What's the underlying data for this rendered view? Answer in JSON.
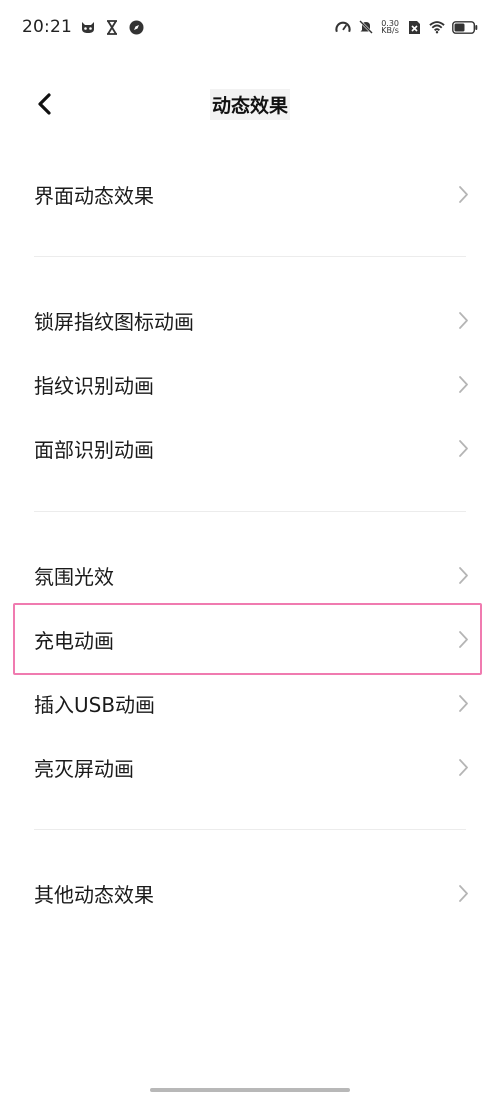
{
  "status_bar": {
    "time": "20:21",
    "net_speed_value": "0.30",
    "net_speed_unit": "KB/s"
  },
  "header": {
    "title": "动态效果"
  },
  "groups": [
    {
      "items": [
        {
          "label": "界面动态效果"
        }
      ]
    },
    {
      "items": [
        {
          "label": "锁屏指纹图标动画"
        },
        {
          "label": "指纹识别动画"
        },
        {
          "label": "面部识别动画"
        }
      ]
    },
    {
      "items": [
        {
          "label": "氛围光效"
        },
        {
          "label": "充电动画"
        },
        {
          "label": "插入USB动画"
        },
        {
          "label": "亮灭屏动画"
        }
      ]
    },
    {
      "items": [
        {
          "label": "其他动态效果"
        }
      ]
    }
  ],
  "colors": {
    "highlight": "#f07bb0",
    "chevron": "#b5b5b5",
    "divider": "#ececec"
  }
}
